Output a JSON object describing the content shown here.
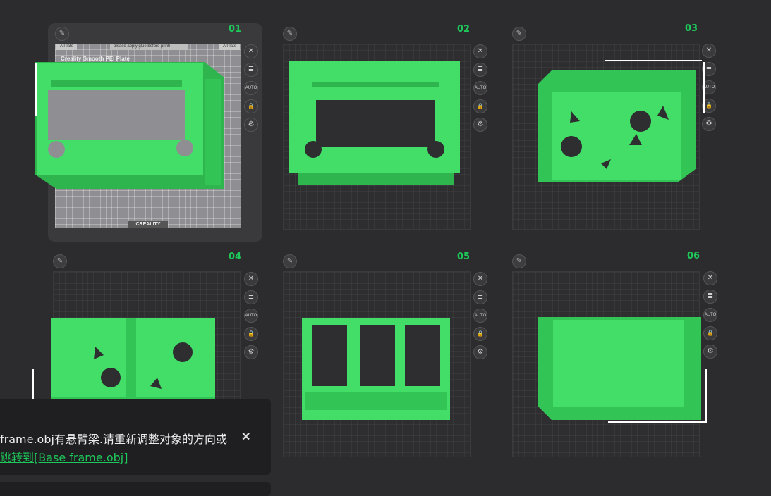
{
  "colors": {
    "accent": "#1ec85a",
    "model": "#3ddc62",
    "background": "#2c2c2e"
  },
  "tools": {
    "close_icon": "✕",
    "list_icon": "≣",
    "auto_label": "AUTO",
    "lock_icon": "🔒",
    "settings_icon": "⚙",
    "edit_icon": "✎"
  },
  "selected_plate": {
    "tab_left": "A Plate",
    "tab_center": "please apply glue before printi",
    "tab_right": "A Plate",
    "title": "Creality Smooth PEI Plate",
    "brand": "CREALITY"
  },
  "plates": [
    {
      "number": "01"
    },
    {
      "number": "02"
    },
    {
      "number": "03"
    },
    {
      "number": "04"
    },
    {
      "number": "05"
    },
    {
      "number": "06"
    }
  ],
  "toast": {
    "message": "frame.obj有悬臂梁.请重新调整对象的方向或",
    "link": "跳转到[Base frame.obj]",
    "close": "✕"
  }
}
